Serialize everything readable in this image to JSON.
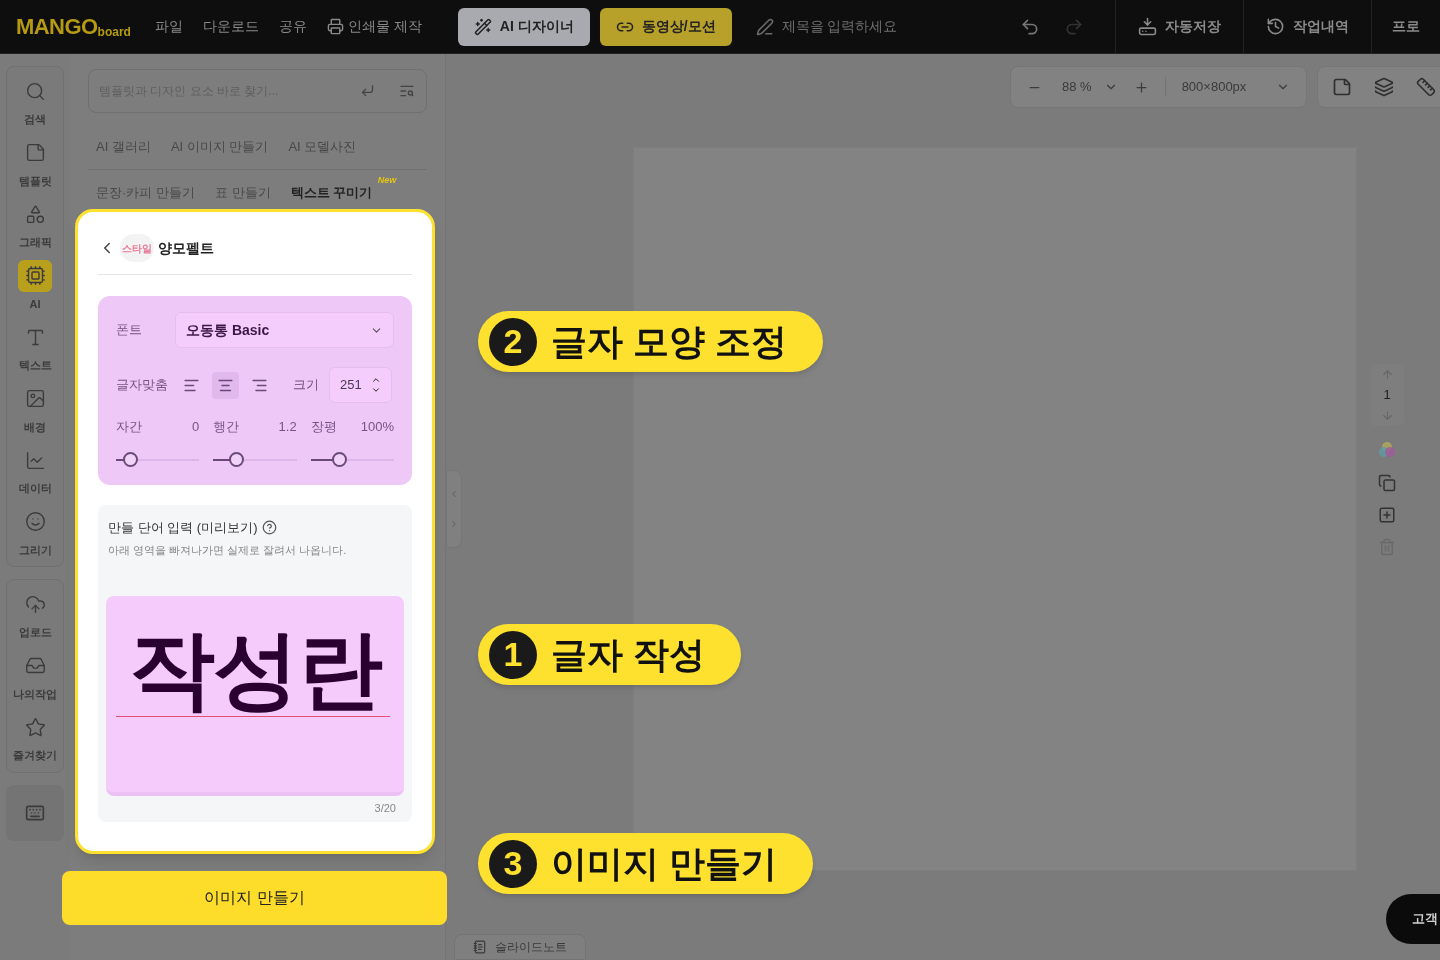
{
  "topbar": {
    "logo": {
      "main": "MANGO",
      "sub": "board"
    },
    "menu": [
      {
        "label": "파일",
        "kind": "text"
      },
      {
        "label": "다운로드",
        "kind": "text"
      },
      {
        "label": "공유",
        "kind": "text"
      },
      {
        "label": "인쇄물 제작",
        "kind": "print"
      }
    ],
    "modes": [
      {
        "label": "AI 디자이너",
        "kind": "ai"
      },
      {
        "label": "동영상/모션",
        "kind": "video"
      }
    ],
    "title_field": {
      "placeholder": "제목을 입력하세요"
    },
    "actions": [
      {
        "label": "자동저장",
        "kind": "save"
      },
      {
        "label": "작업내역",
        "kind": "history"
      }
    ],
    "plan": "프로"
  },
  "rail": {
    "groups": [
      [
        {
          "label": "검색",
          "kind": "search",
          "selected": false
        },
        {
          "label": "템플릿",
          "kind": "template",
          "selected": false
        },
        {
          "label": "그래픽",
          "kind": "graphic",
          "selected": false
        },
        {
          "label": "AI",
          "kind": "ai",
          "selected": true
        },
        {
          "label": "텍스트",
          "kind": "text",
          "selected": false
        },
        {
          "label": "배경",
          "kind": "background",
          "selected": false
        },
        {
          "label": "데이터",
          "kind": "data",
          "selected": false
        },
        {
          "label": "그리기",
          "kind": "draw",
          "selected": false
        }
      ],
      [
        {
          "label": "업로드",
          "kind": "upload",
          "selected": false
        },
        {
          "label": "나의작업",
          "kind": "mywork",
          "selected": false
        },
        {
          "label": "즐겨찾기",
          "kind": "favorite",
          "selected": false
        }
      ]
    ]
  },
  "panel": {
    "search": {
      "placeholder": "템플릿과 디자인 요소 바로 찾기..."
    },
    "tabs_row_1": [
      {
        "label": "AI 갤러리",
        "selected": false
      },
      {
        "label": "AI 이미지 만들기",
        "selected": false
      },
      {
        "label": "AI 모델사진",
        "selected": false
      }
    ],
    "tabs_row_2": [
      {
        "label": "문장·카피 만들기",
        "selected": false
      },
      {
        "label": "표 만들기",
        "selected": false
      },
      {
        "label": "텍스트 꾸미기",
        "selected": true,
        "badge": "New"
      }
    ],
    "card": {
      "style_badge": "스타일",
      "title": "양모펠트",
      "font": {
        "label": "폰트",
        "value": "오동통 Basic"
      },
      "align": {
        "label": "글자맞춤",
        "options": [
          {
            "kind": "left",
            "selected": false
          },
          {
            "kind": "center",
            "selected": true
          },
          {
            "kind": "right",
            "selected": false
          }
        ]
      },
      "size": {
        "label": "크기",
        "value": "251"
      },
      "sliders": [
        {
          "label": "자간",
          "reading": "0",
          "level": 0.17
        },
        {
          "label": "행간",
          "reading": "1.2",
          "level": 0.27
        },
        {
          "label": "장평",
          "reading": "100%",
          "level": 0.34
        }
      ],
      "input": {
        "label": "만들 단어 입력 (미리보기)",
        "hint": "아래 영역을 빠져나가면 실제로 잘려서 나옵니다.",
        "value": "작성란",
        "counter": "3/20"
      }
    },
    "make_button": "이미지 만들기"
  },
  "canvas": {
    "zoom": "88 %",
    "size": "800×800px",
    "page_number": "1",
    "notes_tab": "슬라이드노트",
    "help_button": "고객"
  },
  "callouts": [
    {
      "number": "2",
      "text": "글자 모양 조정"
    },
    {
      "number": "1",
      "text": "글자 작성"
    },
    {
      "number": "3",
      "text": "이미지 만들기"
    }
  ]
}
